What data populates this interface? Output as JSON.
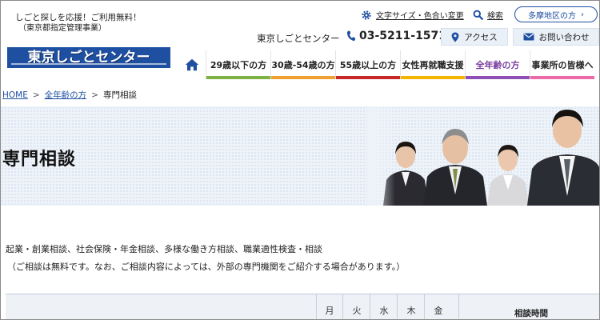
{
  "header": {
    "tagline": "しごと探しを応援！ご利用無料！",
    "tagline_sub": "（東京都指定管理事業）",
    "logo_text": "東京しごとセンター",
    "font_color_link": "文字サイズ・色合い変更",
    "search_link": "検索",
    "area_button": "多摩地区の方",
    "org_name": "東京しごとセンター",
    "phone": "03-5211-1571",
    "access_button": "アクセス",
    "contact_button": "お問い合わせ"
  },
  "nav": {
    "home_icon": "home-icon",
    "items": [
      {
        "label": "29歳以下の方",
        "color": "#7cb342"
      },
      {
        "label": "30歳-54歳の方",
        "color": "#f0a030"
      },
      {
        "label": "55歳以上の方",
        "color": "#c62828"
      },
      {
        "label": "女性再就職支援",
        "color": "#f4b400"
      },
      {
        "label": "全年齢の方",
        "color": "#8e4fb5",
        "active": true
      },
      {
        "label": "事業所の皆様へ",
        "color": "#ec6aa8"
      }
    ]
  },
  "breadcrumb": {
    "home": "HOME",
    "parent": "全年齢の方",
    "current": "専門相談"
  },
  "hero": {
    "title": "専門相談"
  },
  "intro": {
    "line1": "起業・創業相談、社会保険・年金相談、多様な働き方相談、職業適性検査・相談",
    "line2": "（ご相談は無料です。なお、ご相談内容によっては、外部の専門機関をご紹介する場合があります。）"
  },
  "table": {
    "day_headers": [
      "月",
      "火",
      "水",
      "木",
      "金"
    ],
    "hours_header": "相談時間"
  }
}
